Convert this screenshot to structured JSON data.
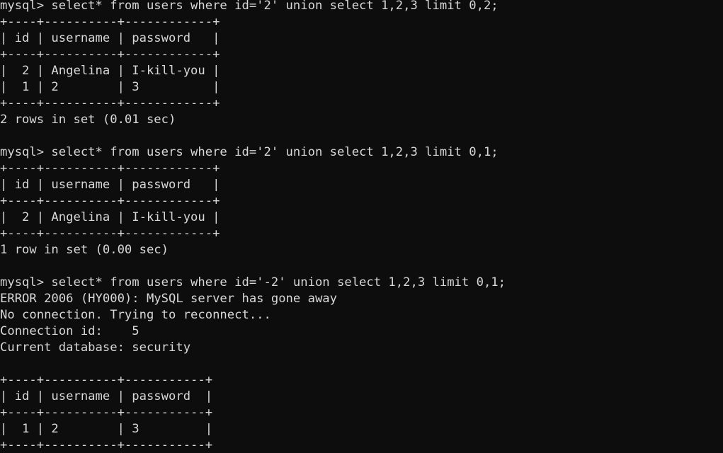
{
  "terminal": {
    "title": "mysql client session",
    "colors": {
      "background": "#0d0d0d",
      "foreground": "#d8d8d8"
    },
    "prompt": "mysql> ",
    "lines": [
      {
        "id": "cmd-1",
        "kind": "command",
        "text": "mysql> select* from users where id='2' union select 1,2,3 limit 0,2;"
      },
      {
        "id": "t1-top",
        "kind": "separator",
        "text": "+----+----------+------------+"
      },
      {
        "id": "t1-header",
        "kind": "header",
        "text": "| id | username | password   |"
      },
      {
        "id": "t1-sep",
        "kind": "separator",
        "text": "+----+----------+------------+"
      },
      {
        "id": "t1-row-1",
        "kind": "row",
        "text": "|  2 | Angelina | I-kill-you |"
      },
      {
        "id": "t1-row-2",
        "kind": "row",
        "text": "|  1 | 2        | 3          |"
      },
      {
        "id": "t1-bottom",
        "kind": "separator",
        "text": "+----+----------+------------+"
      },
      {
        "id": "t1-status",
        "kind": "status",
        "text": "2 rows in set (0.01 sec)"
      },
      {
        "id": "blank-1",
        "kind": "blank",
        "text": ""
      },
      {
        "id": "cmd-2",
        "kind": "command",
        "text": "mysql> select* from users where id='2' union select 1,2,3 limit 0,1;"
      },
      {
        "id": "t2-top",
        "kind": "separator",
        "text": "+----+----------+------------+"
      },
      {
        "id": "t2-header",
        "kind": "header",
        "text": "| id | username | password   |"
      },
      {
        "id": "t2-sep",
        "kind": "separator",
        "text": "+----+----------+------------+"
      },
      {
        "id": "t2-row-1",
        "kind": "row",
        "text": "|  2 | Angelina | I-kill-you |"
      },
      {
        "id": "t2-bottom",
        "kind": "separator",
        "text": "+----+----------+------------+"
      },
      {
        "id": "t2-status",
        "kind": "status",
        "text": "1 row in set (0.00 sec)"
      },
      {
        "id": "blank-2",
        "kind": "blank",
        "text": ""
      },
      {
        "id": "cmd-3",
        "kind": "command",
        "text": "mysql> select* from users where id='-2' union select 1,2,3 limit 0,1;"
      },
      {
        "id": "err-1",
        "kind": "error",
        "text": "ERROR 2006 (HY000): MySQL server has gone away"
      },
      {
        "id": "err-2",
        "kind": "error",
        "text": "No connection. Trying to reconnect..."
      },
      {
        "id": "err-3",
        "kind": "info",
        "text": "Connection id:    5"
      },
      {
        "id": "err-4",
        "kind": "info",
        "text": "Current database: security"
      },
      {
        "id": "blank-3",
        "kind": "blank",
        "text": ""
      },
      {
        "id": "t3-top",
        "kind": "separator",
        "text": "+----+----------+-----------+"
      },
      {
        "id": "t3-header",
        "kind": "header",
        "text": "| id | username | password  |"
      },
      {
        "id": "t3-sep",
        "kind": "separator",
        "text": "+----+----------+-----------+"
      },
      {
        "id": "t3-row-1",
        "kind": "row",
        "text": "|  1 | 2        | 3         |"
      },
      {
        "id": "t3-bottom",
        "kind": "separator",
        "text": "+----+----------+-----------+"
      }
    ],
    "tables": [
      {
        "id": "result-table-1",
        "columns": [
          "id",
          "username",
          "password"
        ],
        "rows": [
          [
            "2",
            "Angelina",
            "I-kill-you"
          ],
          [
            "1",
            "2",
            "3"
          ]
        ],
        "status": "2 rows in set (0.01 sec)"
      },
      {
        "id": "result-table-2",
        "columns": [
          "id",
          "username",
          "password"
        ],
        "rows": [
          [
            "2",
            "Angelina",
            "I-kill-you"
          ]
        ],
        "status": "1 row in set (0.00 sec)"
      },
      {
        "id": "result-table-3",
        "columns": [
          "id",
          "username",
          "password"
        ],
        "rows": [
          [
            "1",
            "2",
            "3"
          ]
        ],
        "status": ""
      }
    ],
    "commands": [
      "select* from users where id='2' union select 1,2,3 limit 0,2;",
      "select* from users where id='2' union select 1,2,3 limit 0,1;",
      "select* from users where id='-2' union select 1,2,3 limit 0,1;"
    ],
    "error_block": {
      "error_code": "ERROR 2006 (HY000)",
      "error_message": "MySQL server has gone away",
      "reconnect_message": "No connection. Trying to reconnect...",
      "connection_id_label": "Connection id:",
      "connection_id_value": "5",
      "current_database_label": "Current database:",
      "current_database_value": "security"
    }
  }
}
